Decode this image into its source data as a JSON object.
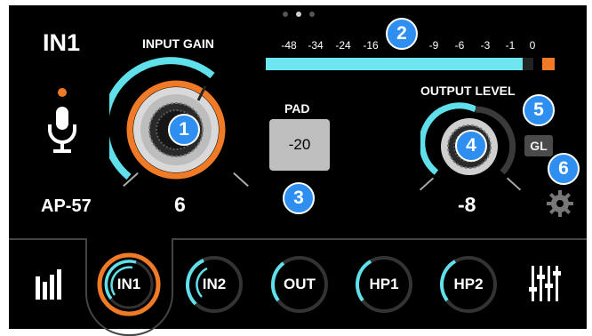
{
  "page_dots": 3,
  "active_page_dot": 1,
  "channel": {
    "name": "IN1",
    "mic_model": "AP-57",
    "phantom_indicator_color": "#f07a26"
  },
  "input_gain": {
    "label": "INPUT GAIN",
    "value": "6",
    "level_fraction": 0.6
  },
  "meter": {
    "scale": [
      "-48",
      "-34",
      "-24",
      "-16",
      "-9",
      "-6",
      "-3",
      "-1",
      "0"
    ],
    "level_fraction": 0.96,
    "clip_color": "#f07a26",
    "bar_color": "#6ee6ef"
  },
  "pad": {
    "label": "PAD",
    "value": "-20"
  },
  "output_level": {
    "label": "OUTPUT LEVEL",
    "value": "-8",
    "level_fraction": 0.45
  },
  "gl_button": "GL",
  "badges": [
    "1",
    "2",
    "3",
    "4",
    "5",
    "6"
  ],
  "tabs": [
    {
      "label": "IN1",
      "active": true,
      "level_fraction": 0.55
    },
    {
      "label": "IN2",
      "active": false,
      "level_fraction": 0.35
    },
    {
      "label": "OUT",
      "active": false,
      "level_fraction": 0.25
    },
    {
      "label": "HP1",
      "active": false,
      "level_fraction": 0.3
    },
    {
      "label": "HP2",
      "active": false,
      "level_fraction": 0.3
    }
  ],
  "icons": {
    "left_tab": "meters-icon",
    "right_tab": "mixer-sliders-icon",
    "settings": "gear-icon",
    "mic": "microphone-icon"
  },
  "colors": {
    "accent_cyan": "#5fe0ea",
    "accent_orange": "#f07a26",
    "badge_blue": "#2f8ff0"
  }
}
